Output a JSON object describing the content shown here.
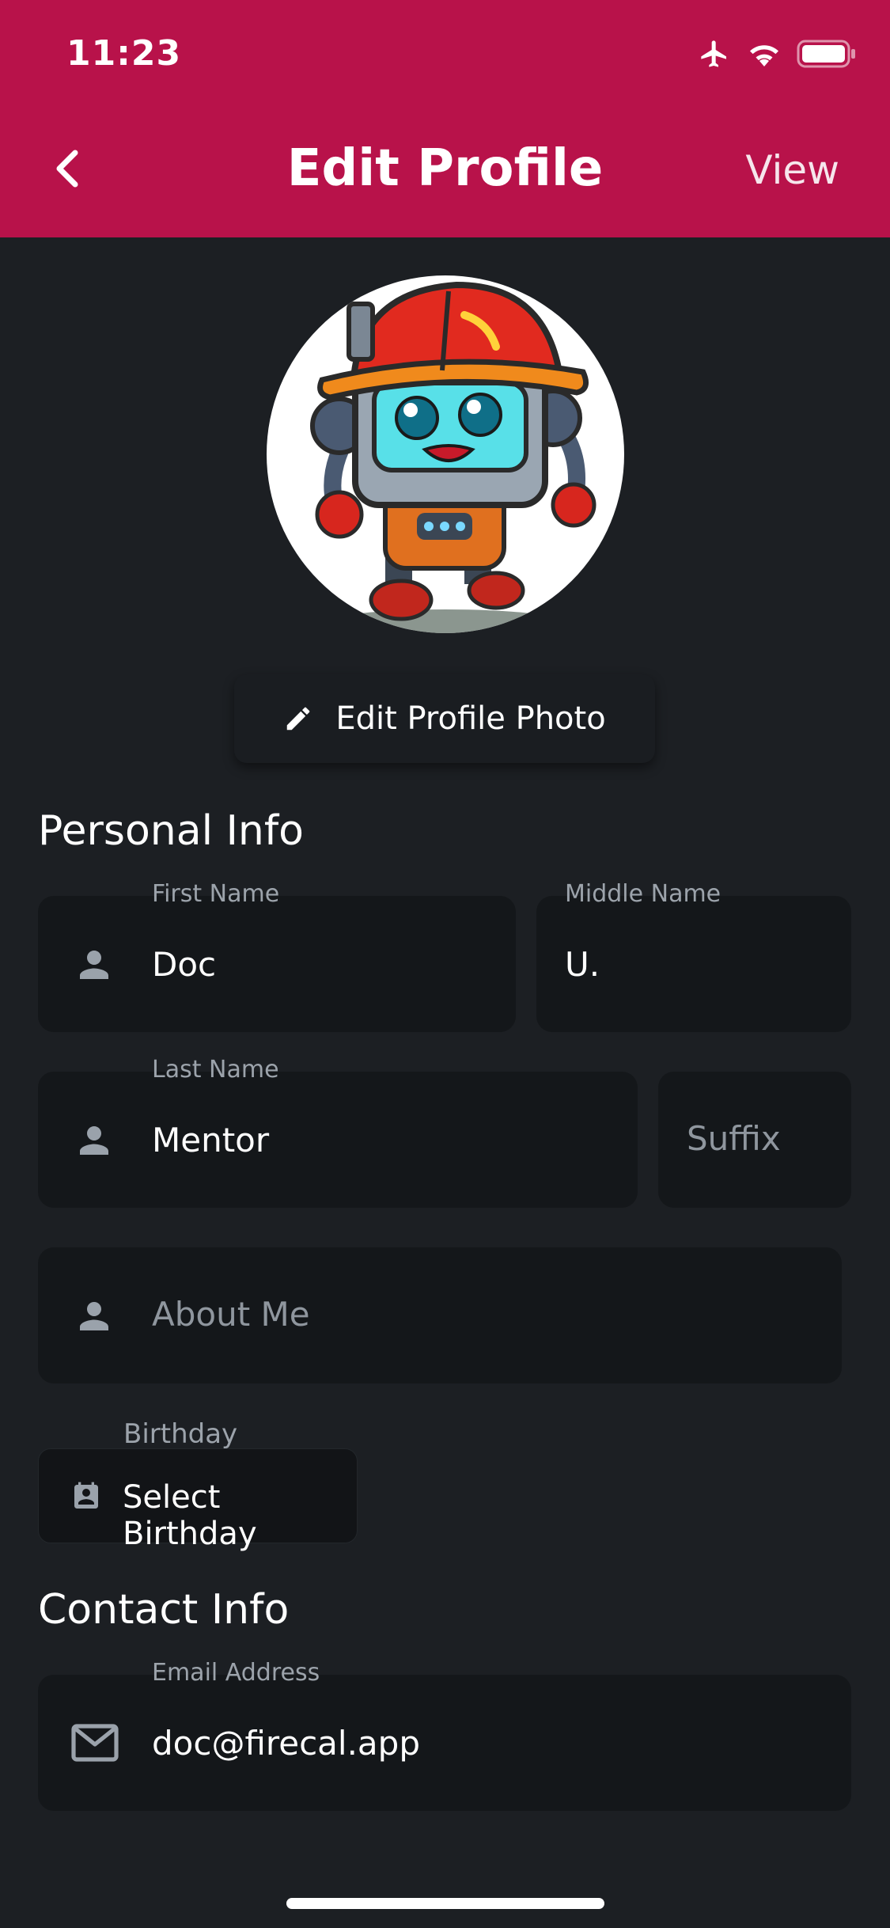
{
  "status_bar": {
    "time": "11:23",
    "icons": [
      "airplane-icon",
      "wifi-icon",
      "battery-icon"
    ]
  },
  "header": {
    "title": "Edit Profile",
    "view_label": "View",
    "back_icon": "chevron-left-icon",
    "color": "#b8124a"
  },
  "profile": {
    "edit_photo_label": "Edit Profile Photo",
    "edit_icon": "pencil-icon"
  },
  "personal_info": {
    "title": "Personal Info",
    "first_name": {
      "label": "First Name",
      "value": "Doc"
    },
    "middle_name": {
      "label": "Middle Name",
      "value": "U."
    },
    "last_name": {
      "label": "Last Name",
      "value": "Mentor"
    },
    "suffix": {
      "placeholder": "Suffix"
    },
    "about_me": {
      "placeholder": "About Me"
    },
    "birthday": {
      "label": "Birthday",
      "button_label": "Select Birthday"
    }
  },
  "contact_info": {
    "title": "Contact Info",
    "email": {
      "label": "Email Address",
      "value": "doc@firecal.app"
    }
  },
  "colors": {
    "background": "#1c1f23",
    "field": "#14171a",
    "accent": "#b8124a"
  }
}
